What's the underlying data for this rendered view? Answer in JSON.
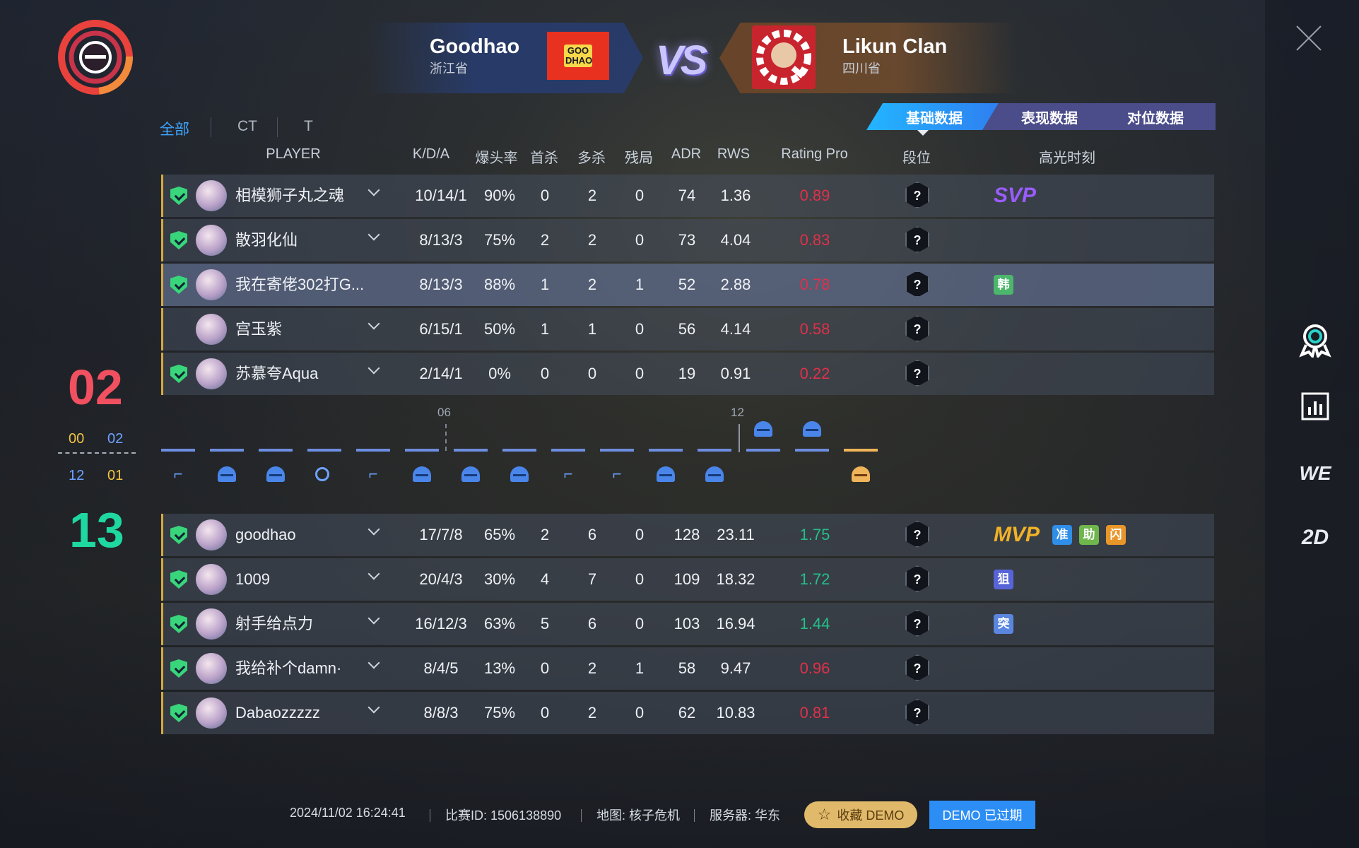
{
  "teams": {
    "left": {
      "name": "Goodhao",
      "province": "浙江省",
      "logo_text": "GOO DHAO"
    },
    "right": {
      "name": "Likun Clan",
      "province": "四川省"
    },
    "vs": "VS"
  },
  "side_tabs": [
    "全部",
    "CT",
    "T"
  ],
  "data_tabs": [
    "基础数据",
    "表现数据",
    "对位数据"
  ],
  "columns": [
    "PLAYER",
    "K/D/A",
    "爆头率",
    "首杀",
    "多杀",
    "残局",
    "ADR",
    "RWS",
    "Rating Pro",
    "段位",
    "高光时刻"
  ],
  "score": {
    "top": "02",
    "bottom": "13",
    "halves_top": [
      "00",
      "02"
    ],
    "halves_bottom": [
      "12",
      "01"
    ]
  },
  "team_top": [
    {
      "name": "相模狮子丸之魂",
      "kda": "10/14/1",
      "hs": "90%",
      "fk": "0",
      "mk": "2",
      "clutch": "0",
      "adr": "74",
      "rws": "1.36",
      "rating": "0.89",
      "rank": "?",
      "highlight": "SVP"
    },
    {
      "name": "散羽化仙",
      "kda": "8/13/3",
      "hs": "75%",
      "fk": "2",
      "mk": "2",
      "clutch": "0",
      "adr": "73",
      "rws": "4.04",
      "rating": "0.83",
      "rank": "?"
    },
    {
      "name": "我在寄佬302打G...",
      "kda": "8/13/3",
      "hs": "88%",
      "fk": "1",
      "mk": "2",
      "clutch": "1",
      "adr": "52",
      "rws": "2.88",
      "rating": "0.78",
      "rank": "?",
      "badges": [
        "韩"
      ]
    },
    {
      "name": "宫玉紫",
      "kda": "6/15/1",
      "hs": "50%",
      "fk": "1",
      "mk": "1",
      "clutch": "0",
      "adr": "56",
      "rws": "4.14",
      "rating": "0.58",
      "rank": "?"
    },
    {
      "name": "苏慕夸Aqua",
      "kda": "2/14/1",
      "hs": "0%",
      "fk": "0",
      "mk": "0",
      "clutch": "0",
      "adr": "19",
      "rws": "0.91",
      "rating": "0.22",
      "rank": "?"
    }
  ],
  "team_bottom": [
    {
      "name": "goodhao",
      "kda": "17/7/8",
      "hs": "65%",
      "fk": "2",
      "mk": "6",
      "clutch": "0",
      "adr": "128",
      "rws": "23.11",
      "rating": "1.75",
      "rank": "?",
      "highlight": "MVP",
      "badges": [
        "准",
        "助",
        "闪"
      ]
    },
    {
      "name": "1009",
      "kda": "20/4/3",
      "hs": "30%",
      "fk": "4",
      "mk": "7",
      "clutch": "0",
      "adr": "109",
      "rws": "18.32",
      "rating": "1.72",
      "rank": "?",
      "badges": [
        "狙"
      ]
    },
    {
      "name": "射手给点力",
      "kda": "16/12/3",
      "hs": "63%",
      "fk": "5",
      "mk": "6",
      "clutch": "0",
      "adr": "103",
      "rws": "16.94",
      "rating": "1.44",
      "rank": "?",
      "badges": [
        "突"
      ]
    },
    {
      "name": "我给补个damn·",
      "kda": "8/4/5",
      "hs": "13%",
      "fk": "0",
      "mk": "2",
      "clutch": "1",
      "adr": "58",
      "rws": "9.47",
      "rating": "0.96",
      "rank": "?"
    },
    {
      "name": "Dabaozzzzz",
      "kda": "8/8/3",
      "hs": "75%",
      "fk": "0",
      "mk": "2",
      "clutch": "0",
      "adr": "62",
      "rws": "10.83",
      "rating": "0.81",
      "rank": "?"
    }
  ],
  "timeline": {
    "labels": [
      "06",
      "12"
    ],
    "rounds": [
      {
        "icon": "defuse-kit-icon"
      },
      {
        "icon": "ct-helmet-icon"
      },
      {
        "icon": "ct-helmet-icon"
      },
      {
        "icon": "bomb-icon"
      },
      {
        "icon": "defuse-kit-icon"
      },
      {
        "icon": "ct-helmet-icon"
      },
      {
        "icon": "ct-helmet-icon"
      },
      {
        "icon": "ct-helmet-icon"
      },
      {
        "icon": "defuse-kit-icon"
      },
      {
        "icon": "defuse-kit-icon"
      },
      {
        "icon": "ct-helmet-icon"
      },
      {
        "icon": "ct-helmet-icon"
      },
      {
        "icon": "ct-helmet-icon"
      },
      {
        "icon": "ct-helmet-icon"
      },
      {
        "icon": "t-helmet-icon"
      }
    ]
  },
  "right_icons": [
    "medal-icon",
    "stats-chart-icon",
    "WE",
    "2D"
  ],
  "footer": {
    "datetime": "2024/11/02 16:24:41",
    "match_id": "比赛ID: 1506138890",
    "map": "地图: 核子危机",
    "server": "服务器: 华东",
    "fav_button": "收藏 DEMO",
    "demo_button": "DEMO 已过期"
  },
  "colors": {
    "accent": "#2c8ef5",
    "loss_score": "#f0505f",
    "win_score": "#1fd7a0",
    "rating_low": "#e0304a",
    "rating_high": "#23c08a",
    "gold": "#d6a93a"
  }
}
